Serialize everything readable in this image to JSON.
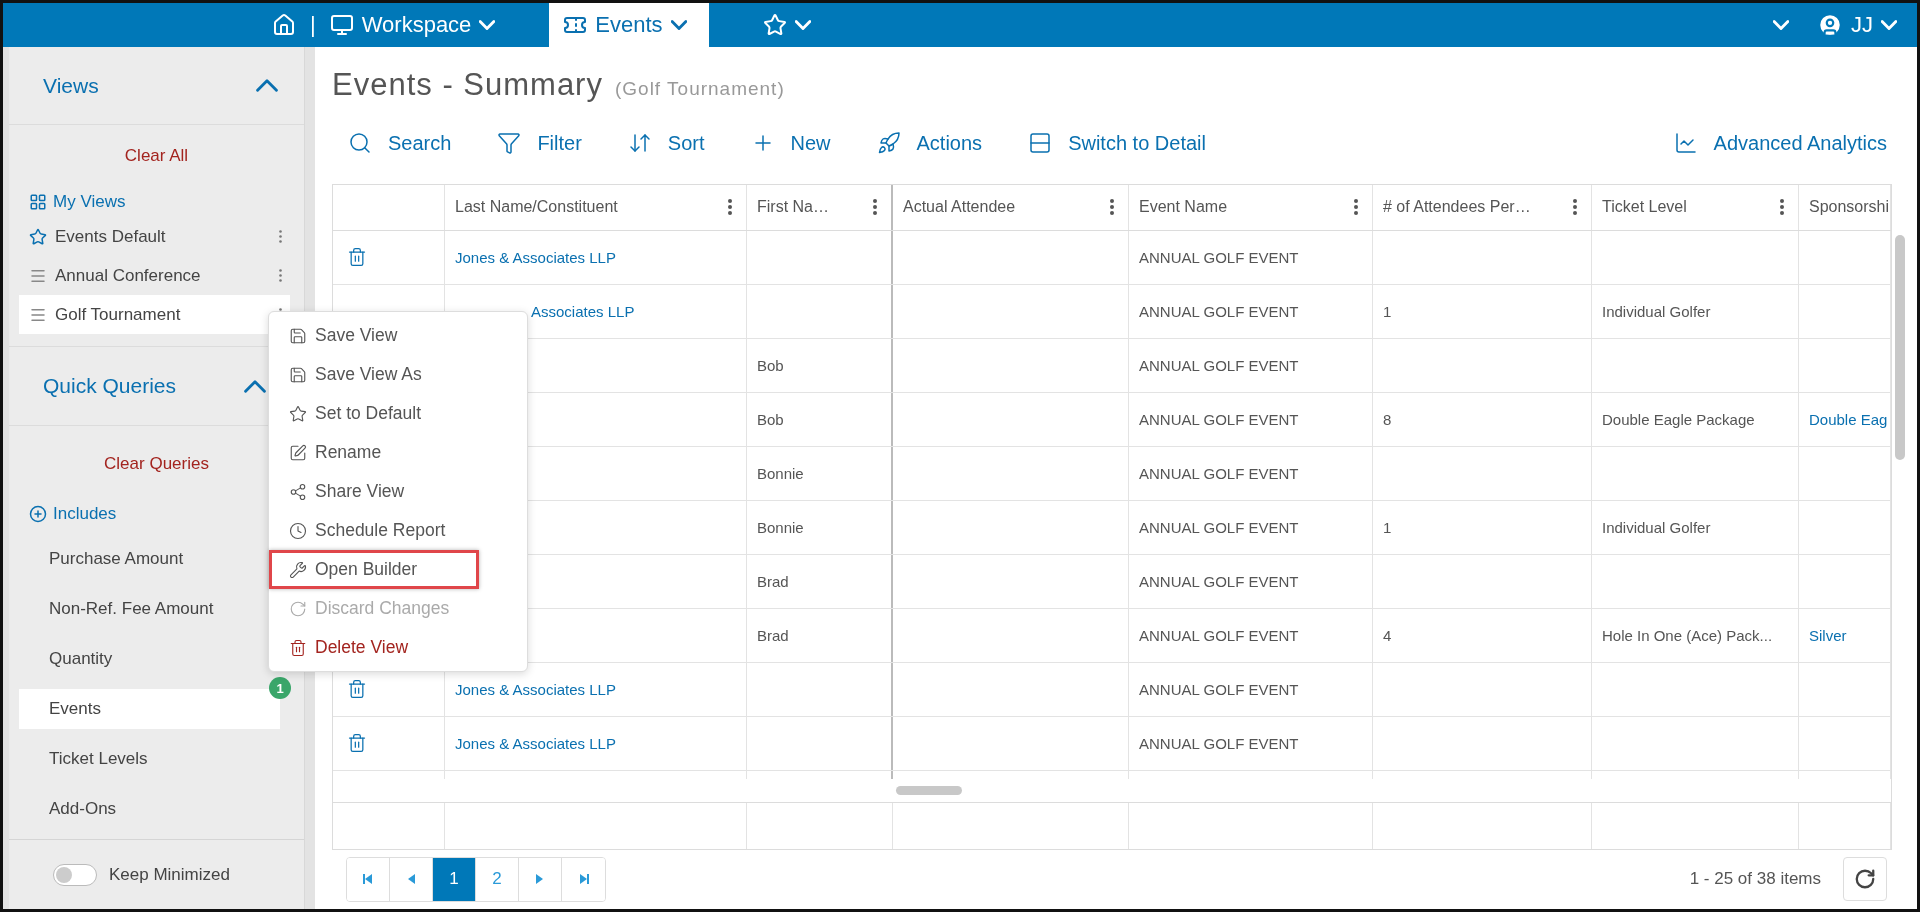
{
  "topbar": {
    "separator": "|",
    "tabs": [
      {
        "label": "Workspace",
        "selected": false
      },
      {
        "label": "Events",
        "selected": true
      }
    ],
    "user": "JJ"
  },
  "sidebar": {
    "views": {
      "title": "Views",
      "expanded": true,
      "clear": "Clear All",
      "my_views": "My Views",
      "items": [
        {
          "label": "Events Default",
          "kind": "default",
          "selected": false
        },
        {
          "label": "Annual Conference",
          "kind": "view",
          "selected": false
        },
        {
          "label": "Golf Tournament",
          "kind": "view",
          "selected": true
        }
      ]
    },
    "quick_queries": {
      "title": "Quick Queries",
      "expanded": true,
      "clear": "Clear Queries",
      "includes": "Includes",
      "items": [
        {
          "label": "Purchase Amount",
          "selected": false
        },
        {
          "label": "Non-Ref. Fee Amount",
          "selected": false
        },
        {
          "label": "Quantity",
          "selected": false
        },
        {
          "label": "Events",
          "selected": true,
          "badge": "1"
        },
        {
          "label": "Ticket Levels",
          "selected": false
        },
        {
          "label": "Add-Ons",
          "selected": false
        }
      ]
    },
    "keep_minimized": {
      "label": "Keep Minimized",
      "on": false
    }
  },
  "page": {
    "title": "Events - Summary",
    "subtitle": "(Golf Tournament)"
  },
  "toolbar": [
    {
      "label": "Search"
    },
    {
      "label": "Filter"
    },
    {
      "label": "Sort"
    },
    {
      "label": "New"
    },
    {
      "label": "Actions"
    },
    {
      "label": "Switch to Detail"
    }
  ],
  "toolbar_right": {
    "label": "Advanced Analytics"
  },
  "table": {
    "columns": [
      {
        "label": "Last Name/Constituent",
        "kind": "link",
        "menu": true
      },
      {
        "label": "First Na…",
        "kind": "text",
        "menu": true
      },
      {
        "label": "Actual Attendee",
        "kind": "text",
        "menu": true
      },
      {
        "label": "Event Name",
        "kind": "text",
        "menu": true
      },
      {
        "label": "# of Attendees Per…",
        "kind": "text",
        "menu": true
      },
      {
        "label": "Ticket Level",
        "kind": "text",
        "menu": true
      },
      {
        "label": "Sponsorshi",
        "kind": "link"
      }
    ],
    "rows": [
      {
        "cells": [
          "Jones & Associates LLP",
          null,
          null,
          "ANNUAL GOLF EVENT",
          null,
          null,
          null
        ]
      },
      {
        "partly_hidden": true,
        "cells": [
          "Associates LLP",
          null,
          null,
          "ANNUAL GOLF EVENT",
          "1",
          "Individual Golfer",
          null
        ]
      },
      {
        "cells": [
          null,
          "Bob",
          null,
          "ANNUAL GOLF EVENT",
          null,
          null,
          null
        ]
      },
      {
        "cells": [
          null,
          "Bob",
          null,
          "ANNUAL GOLF EVENT",
          "8",
          "Double Eagle Package",
          "Double Eag"
        ]
      },
      {
        "cells": [
          null,
          "Bonnie",
          null,
          "ANNUAL GOLF EVENT",
          null,
          null,
          null
        ]
      },
      {
        "cells": [
          null,
          "Bonnie",
          null,
          "ANNUAL GOLF EVENT",
          "1",
          "Individual Golfer",
          null
        ]
      },
      {
        "cells": [
          null,
          "Brad",
          null,
          "ANNUAL GOLF EVENT",
          null,
          null,
          null
        ]
      },
      {
        "cells": [
          null,
          "Brad",
          null,
          "ANNUAL GOLF EVENT",
          "4",
          "Hole In One (Ace) Pack...",
          "Silver"
        ]
      },
      {
        "cells": [
          "Jones & Associates LLP",
          null,
          null,
          "ANNUAL GOLF EVENT",
          null,
          null,
          null
        ]
      },
      {
        "cells": [
          "Jones & Associates LLP",
          null,
          null,
          "ANNUAL GOLF EVENT",
          null,
          null,
          null
        ]
      }
    ]
  },
  "pagination": {
    "pages": [
      {
        "label": "1",
        "selected": true
      },
      {
        "label": "2",
        "selected": false
      }
    ],
    "summary": "1 - 25 of 38 items"
  },
  "context_menu": {
    "items": [
      {
        "label": "Save View",
        "kind": "normal",
        "highlighted": false
      },
      {
        "label": "Save View As",
        "kind": "normal",
        "highlighted": false
      },
      {
        "label": "Set to Default",
        "kind": "normal",
        "highlighted": false
      },
      {
        "label": "Rename",
        "kind": "normal",
        "highlighted": false
      },
      {
        "label": "Share View",
        "kind": "normal",
        "highlighted": false
      },
      {
        "label": "Schedule Report",
        "kind": "normal",
        "highlighted": false
      },
      {
        "label": "Open Builder",
        "kind": "normal",
        "highlighted": true
      },
      {
        "label": "Discard Changes",
        "kind": "disabled",
        "highlighted": false
      },
      {
        "label": "Delete View",
        "kind": "danger",
        "highlighted": false
      }
    ]
  }
}
